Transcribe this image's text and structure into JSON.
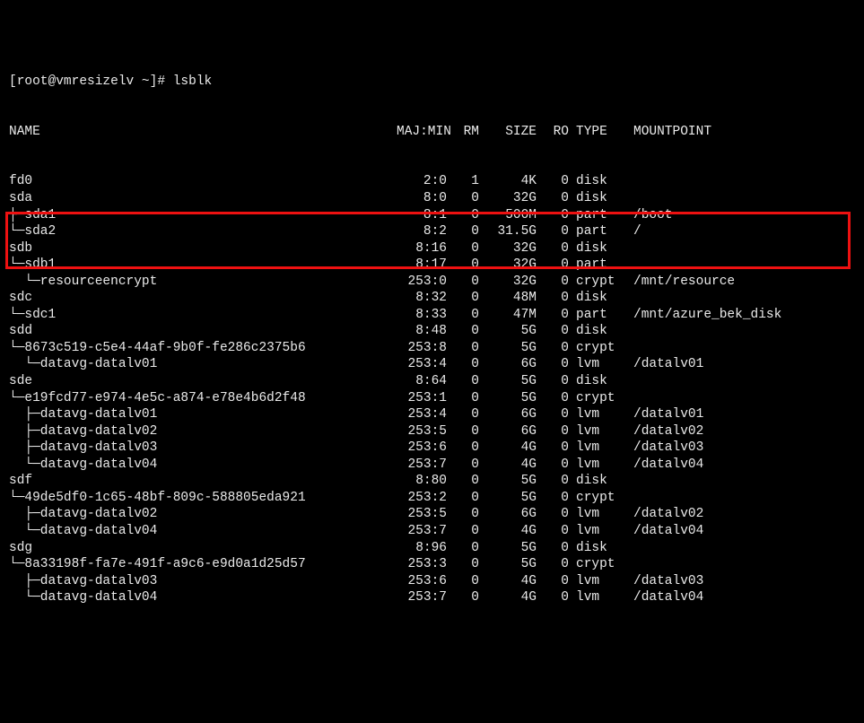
{
  "prompt": "[root@vmresizelv ~]# lsblk",
  "header": {
    "name": "NAME",
    "majmin": "MAJ:MIN",
    "rm": "RM",
    "size": "SIZE",
    "ro": "RO",
    "type": "TYPE",
    "mountpoint": "MOUNTPOINT"
  },
  "rows": [
    {
      "tree": "fd0",
      "maj": "2:0",
      "rm": "1",
      "size": "4K",
      "ro": "0",
      "type": "disk",
      "mnt": ""
    },
    {
      "tree": "sda",
      "maj": "8:0",
      "rm": "0",
      "size": "32G",
      "ro": "0",
      "type": "disk",
      "mnt": ""
    },
    {
      "tree": "├─sda1",
      "maj": "8:1",
      "rm": "0",
      "size": "500M",
      "ro": "0",
      "type": "part",
      "mnt": "/boot"
    },
    {
      "tree": "└─sda2",
      "maj": "8:2",
      "rm": "0",
      "size": "31.5G",
      "ro": "0",
      "type": "part",
      "mnt": "/"
    },
    {
      "tree": "sdb",
      "maj": "8:16",
      "rm": "0",
      "size": "32G",
      "ro": "0",
      "type": "disk",
      "mnt": ""
    },
    {
      "tree": "└─sdb1",
      "maj": "8:17",
      "rm": "0",
      "size": "32G",
      "ro": "0",
      "type": "part",
      "mnt": ""
    },
    {
      "tree": "  └─resourceencrypt",
      "maj": "253:0",
      "rm": "0",
      "size": "32G",
      "ro": "0",
      "type": "crypt",
      "mnt": "/mnt/resource"
    },
    {
      "tree": "sdc",
      "maj": "8:32",
      "rm": "0",
      "size": "48M",
      "ro": "0",
      "type": "disk",
      "mnt": ""
    },
    {
      "tree": "└─sdc1",
      "maj": "8:33",
      "rm": "0",
      "size": "47M",
      "ro": "0",
      "type": "part",
      "mnt": "/mnt/azure_bek_disk"
    },
    {
      "tree": "sdd",
      "maj": "8:48",
      "rm": "0",
      "size": "5G",
      "ro": "0",
      "type": "disk",
      "mnt": ""
    },
    {
      "tree": "└─8673c519-c5e4-44af-9b0f-fe286c2375b6",
      "maj": "253:8",
      "rm": "0",
      "size": "5G",
      "ro": "0",
      "type": "crypt",
      "mnt": ""
    },
    {
      "tree": "  └─datavg-datalv01",
      "maj": "253:4",
      "rm": "0",
      "size": "6G",
      "ro": "0",
      "type": "lvm",
      "mnt": "/datalv01"
    },
    {
      "tree": "sde",
      "maj": "8:64",
      "rm": "0",
      "size": "5G",
      "ro": "0",
      "type": "disk",
      "mnt": ""
    },
    {
      "tree": "└─e19fcd77-e974-4e5c-a874-e78e4b6d2f48",
      "maj": "253:1",
      "rm": "0",
      "size": "5G",
      "ro": "0",
      "type": "crypt",
      "mnt": ""
    },
    {
      "tree": "  ├─datavg-datalv01",
      "maj": "253:4",
      "rm": "0",
      "size": "6G",
      "ro": "0",
      "type": "lvm",
      "mnt": "/datalv01"
    },
    {
      "tree": "  ├─datavg-datalv02",
      "maj": "253:5",
      "rm": "0",
      "size": "6G",
      "ro": "0",
      "type": "lvm",
      "mnt": "/datalv02"
    },
    {
      "tree": "  ├─datavg-datalv03",
      "maj": "253:6",
      "rm": "0",
      "size": "4G",
      "ro": "0",
      "type": "lvm",
      "mnt": "/datalv03"
    },
    {
      "tree": "  └─datavg-datalv04",
      "maj": "253:7",
      "rm": "0",
      "size": "4G",
      "ro": "0",
      "type": "lvm",
      "mnt": "/datalv04"
    },
    {
      "tree": "sdf",
      "maj": "8:80",
      "rm": "0",
      "size": "5G",
      "ro": "0",
      "type": "disk",
      "mnt": ""
    },
    {
      "tree": "└─49de5df0-1c65-48bf-809c-588805eda921",
      "maj": "253:2",
      "rm": "0",
      "size": "5G",
      "ro": "0",
      "type": "crypt",
      "mnt": ""
    },
    {
      "tree": "  ├─datavg-datalv02",
      "maj": "253:5",
      "rm": "0",
      "size": "6G",
      "ro": "0",
      "type": "lvm",
      "mnt": "/datalv02"
    },
    {
      "tree": "  └─datavg-datalv04",
      "maj": "253:7",
      "rm": "0",
      "size": "4G",
      "ro": "0",
      "type": "lvm",
      "mnt": "/datalv04"
    },
    {
      "tree": "sdg",
      "maj": "8:96",
      "rm": "0",
      "size": "5G",
      "ro": "0",
      "type": "disk",
      "mnt": ""
    },
    {
      "tree": "└─8a33198f-fa7e-491f-a9c6-e9d0a1d25d57",
      "maj": "253:3",
      "rm": "0",
      "size": "5G",
      "ro": "0",
      "type": "crypt",
      "mnt": ""
    },
    {
      "tree": "  ├─datavg-datalv03",
      "maj": "253:6",
      "rm": "0",
      "size": "4G",
      "ro": "0",
      "type": "lvm",
      "mnt": "/datalv03"
    },
    {
      "tree": "  └─datavg-datalv04",
      "maj": "253:7",
      "rm": "0",
      "size": "4G",
      "ro": "0",
      "type": "lvm",
      "mnt": "/datalv04"
    }
  ]
}
